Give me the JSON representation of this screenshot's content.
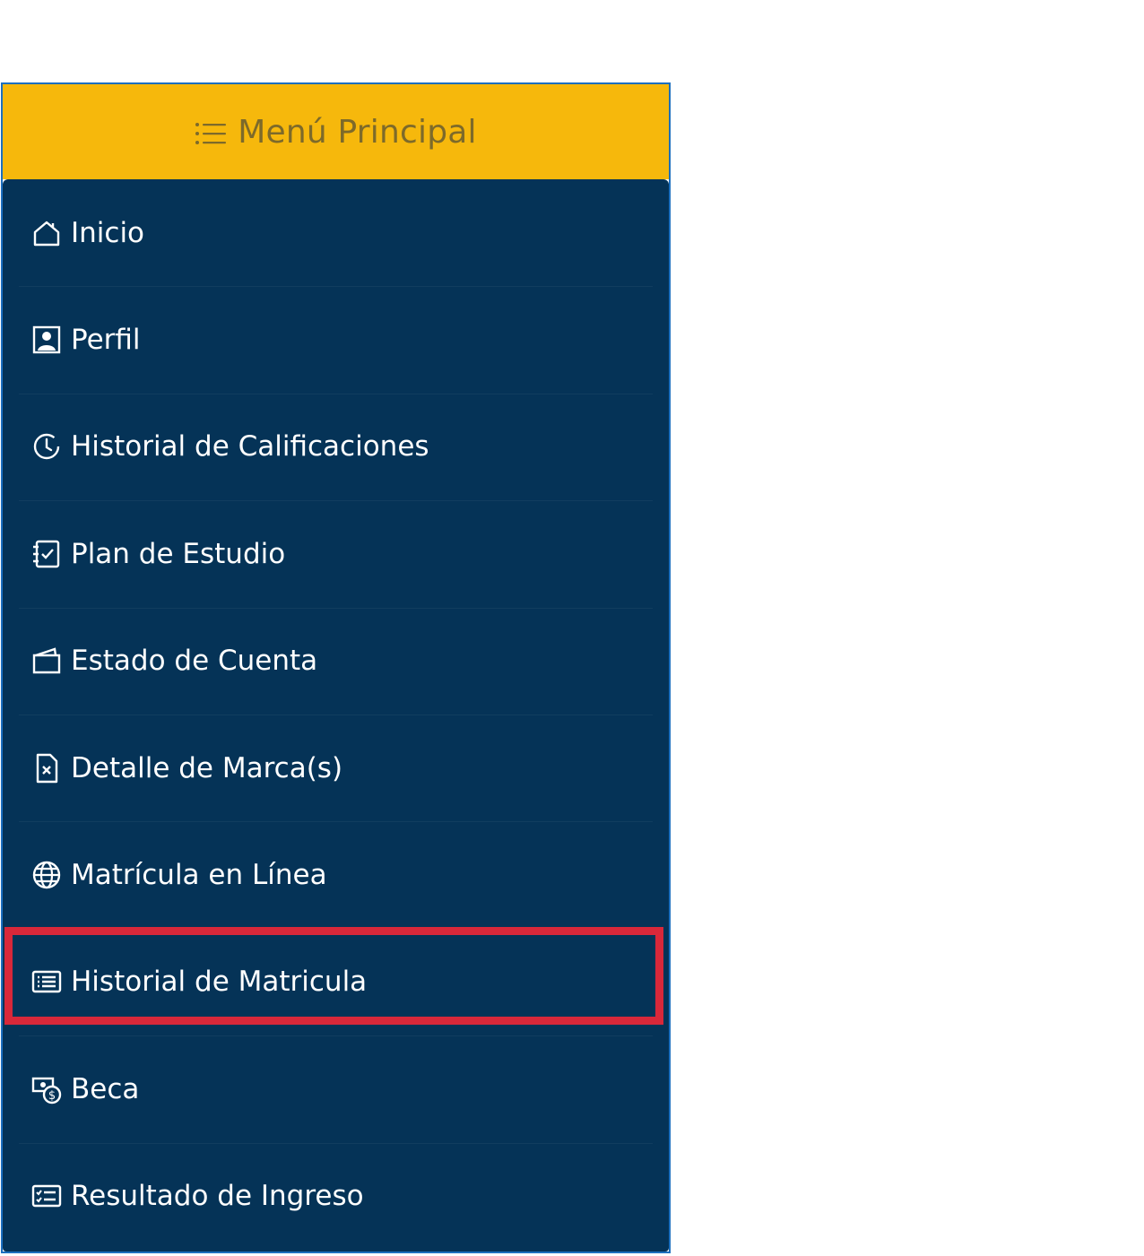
{
  "menu": {
    "title": "Menú Principal",
    "title_icon": "list-icon",
    "items": [
      {
        "label": "Inicio",
        "icon": "house-icon"
      },
      {
        "label": "Perfil",
        "icon": "person-badge-icon"
      },
      {
        "label": "Historial de Calificaciones",
        "icon": "clock-history-icon"
      },
      {
        "label": "Plan de Estudio",
        "icon": "journal-check-icon"
      },
      {
        "label": "Estado de Cuenta",
        "icon": "wallet-icon"
      },
      {
        "label": "Detalle de Marca(s)",
        "icon": "file-x-icon"
      },
      {
        "label": "Matrícula en Línea",
        "icon": "globe-icon"
      },
      {
        "label": "Historial de Matricula",
        "icon": "card-list-icon",
        "highlighted": true
      },
      {
        "label": "Beca",
        "icon": "cash-coin-icon"
      },
      {
        "label": "Resultado de Ingreso",
        "icon": "card-checklist-icon"
      }
    ]
  },
  "colors": {
    "header_bg": "#f6b80c",
    "header_text": "#7d6a2a",
    "menu_bg": "#053357",
    "menu_text": "#ffffff",
    "frame_border": "#1d6fbf",
    "highlight_border": "#d8283a"
  }
}
